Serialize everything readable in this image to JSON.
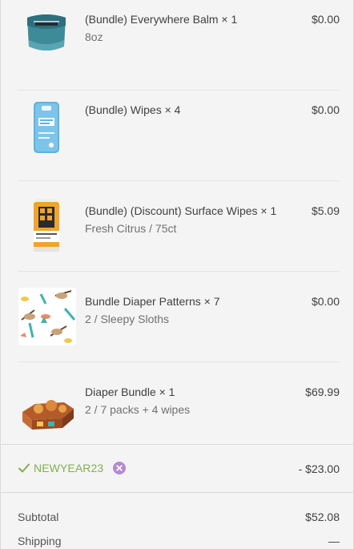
{
  "items": [
    {
      "name": "(Bundle) Everywhere Balm × 1",
      "variant": "8oz",
      "price": "$0.00",
      "image": "balm-jar"
    },
    {
      "name": "(Bundle) Wipes × 4",
      "variant": "",
      "price": "$0.00",
      "image": "wipes-pack"
    },
    {
      "name": "(Bundle) (Discount) Surface Wipes × 1",
      "variant": "Fresh Citrus / 75ct",
      "price": "$5.09",
      "image": "surface-wipes-canister"
    },
    {
      "name": "Bundle Diaper Patterns × 7",
      "variant": "2 / Sleepy Sloths",
      "price": "$0.00",
      "image": "sloth-pattern"
    },
    {
      "name": "Diaper Bundle × 1",
      "variant": "2 / 7 packs + 4 wipes",
      "price": "$69.99",
      "image": "diaper-box"
    }
  ],
  "discount": {
    "code": "NEWYEAR23",
    "amount": "- $23.00",
    "check_icon": "check-icon",
    "remove_icon": "remove-icon"
  },
  "totals": {
    "subtotal_label": "Subtotal",
    "subtotal_value": "$52.08",
    "shipping_label": "Shipping",
    "shipping_value": "—"
  },
  "colors": {
    "discount_green": "#7fb04e",
    "remove_purple": "#b58ad0",
    "background": "#f4f4f4"
  }
}
